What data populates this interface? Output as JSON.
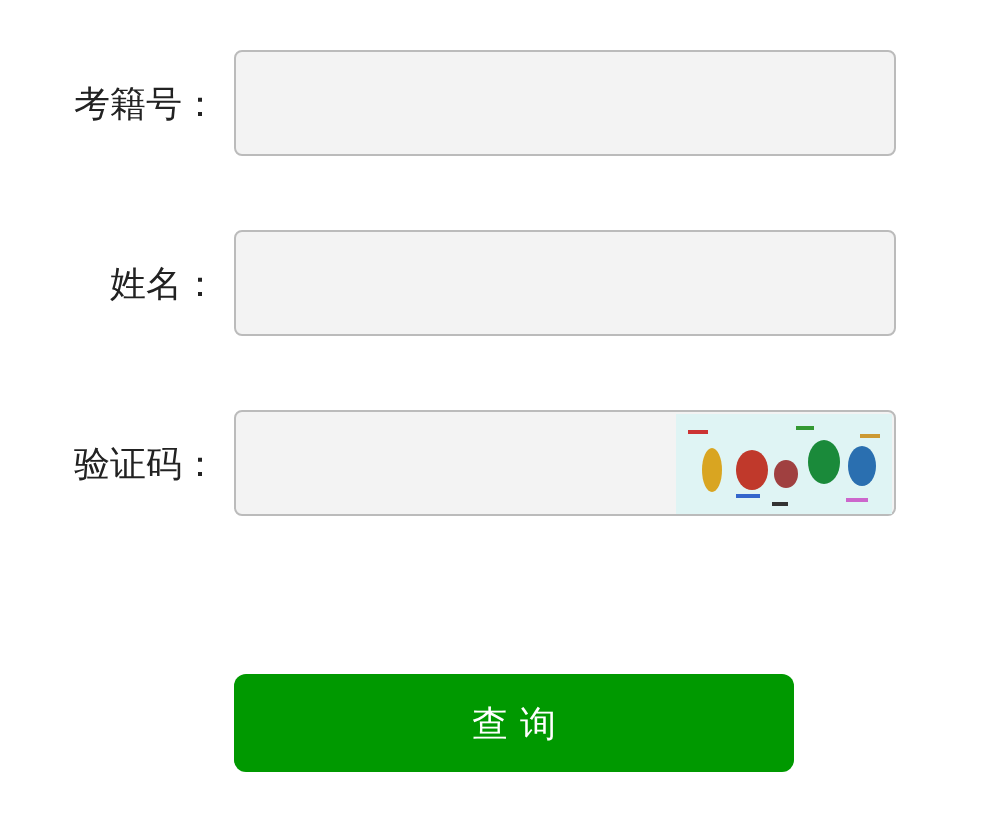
{
  "form": {
    "fields": [
      {
        "kind": "text",
        "label": "考籍号："
      },
      {
        "kind": "text",
        "label": "姓名："
      },
      {
        "kind": "captcha",
        "label": "验证码："
      }
    ],
    "submit": "查 询"
  }
}
